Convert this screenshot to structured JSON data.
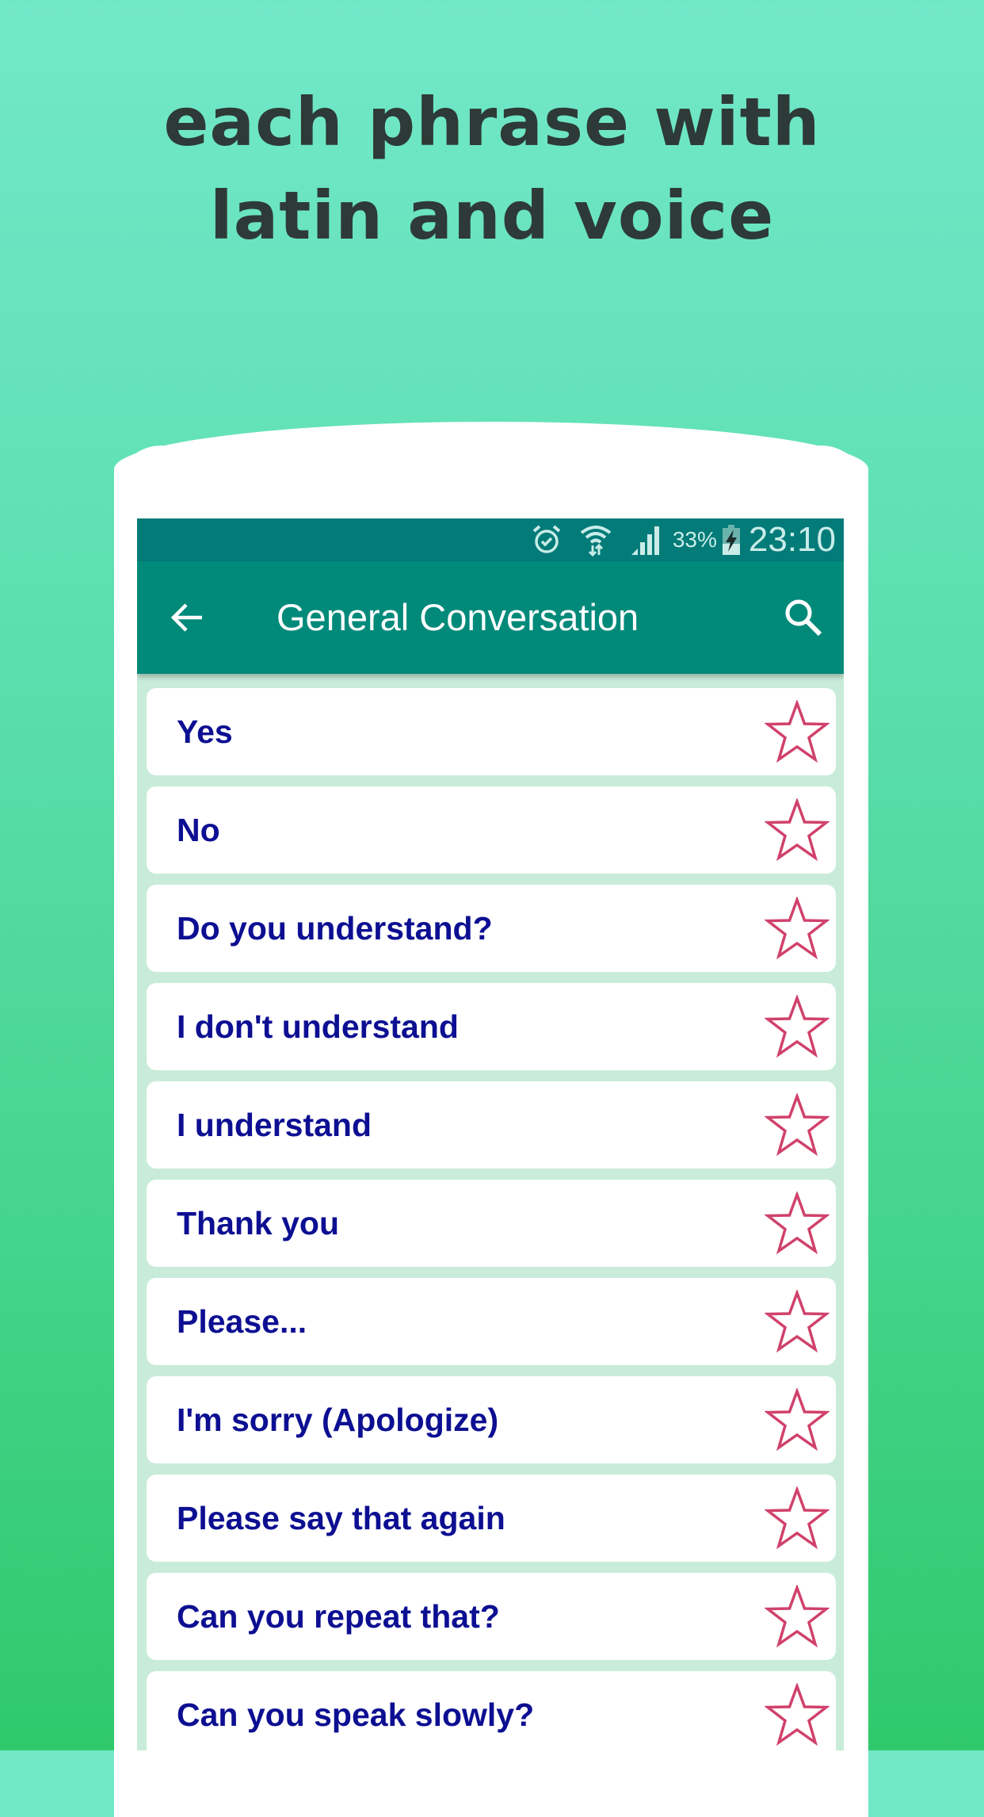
{
  "promo": {
    "headline_line1": "each phrase with",
    "headline_line2": "latin and voice"
  },
  "status_bar": {
    "icons": [
      "alarm-icon",
      "wifi-icon",
      "signal-icon",
      "battery-charging-icon"
    ],
    "battery_percent": "33%",
    "time": "23:10"
  },
  "app_bar": {
    "back_icon": "arrow-left-icon",
    "title": "General Conversation",
    "search_icon": "search-icon"
  },
  "colors": {
    "status_bar": "#037b78",
    "app_bar": "#018a7a",
    "phrase_text": "#0d0f92",
    "star_outline": "#d0416b",
    "list_background": "#c8ecd9"
  },
  "phrases": [
    {
      "text": "Yes",
      "favorite": false
    },
    {
      "text": "No",
      "favorite": false
    },
    {
      "text": "Do you understand?",
      "favorite": false
    },
    {
      "text": "I don't understand",
      "favorite": false
    },
    {
      "text": "I understand",
      "favorite": false
    },
    {
      "text": "Thank you",
      "favorite": false
    },
    {
      "text": "Please...",
      "favorite": false
    },
    {
      "text": "I'm sorry (Apologize)",
      "favorite": false
    },
    {
      "text": "Please say that again",
      "favorite": false
    },
    {
      "text": "Can you repeat that?",
      "favorite": false
    },
    {
      "text": "Can you speak slowly?",
      "favorite": false
    }
  ]
}
